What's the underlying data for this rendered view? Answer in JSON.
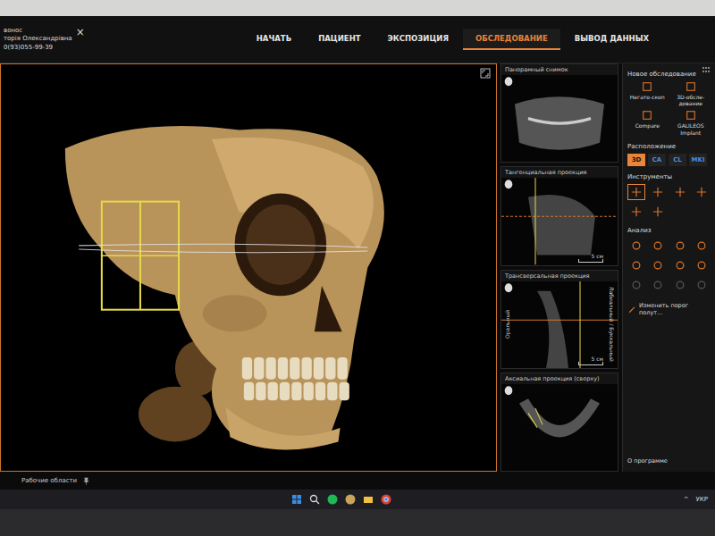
{
  "patient": {
    "lines": [
      "вонос",
      "торія Олександрівна",
      "0(93)055-99-39"
    ],
    "close": "×"
  },
  "nav": [
    {
      "label": "НАЧАТЬ",
      "selected": false
    },
    {
      "label": "ПАЦИЕНТ",
      "selected": false
    },
    {
      "label": "ЭКСПОЗИЦИЯ",
      "selected": false
    },
    {
      "label": "ОБСЛЕДОВАНИЕ",
      "selected": true
    },
    {
      "label": "ВЫВОД ДАННЫХ",
      "selected": false
    }
  ],
  "views": [
    {
      "title": "Панорамный снимок",
      "kind": "panorama",
      "scale": "",
      "side_labels": []
    },
    {
      "title": "Тангенциальная проекция",
      "kind": "tangential",
      "scale": "5 см",
      "side_labels": []
    },
    {
      "title": "Трансверсальная проекция",
      "kind": "transverse",
      "scale": "5 см",
      "side_labels": [
        "Оральный",
        "Лабиальный / Буккальный"
      ]
    },
    {
      "title": "Аксиальная проекция (сверху)",
      "kind": "axial",
      "scale": "",
      "side_labels": []
    }
  ],
  "tools_panel": {
    "new_exam": {
      "title": "Новое обследование",
      "items": [
        {
          "label": "Негато-скоп"
        },
        {
          "label": "3D-обсле-дование"
        },
        {
          "label": "Compare"
        },
        {
          "label": "GALILEOS Implant"
        }
      ]
    },
    "layout": {
      "title": "Расположение",
      "options": [
        {
          "label": "3D",
          "selected": true
        },
        {
          "label": "CA",
          "selected": false
        },
        {
          "label": "CL",
          "selected": false
        },
        {
          "label": "MKI",
          "selected": false
        }
      ]
    },
    "instruments": {
      "title": "Инструменты",
      "tools": [
        {
          "selected": true
        },
        {
          "selected": false
        },
        {
          "selected": false
        },
        {
          "selected": false
        },
        {
          "selected": false
        },
        {
          "selected": false
        }
      ]
    },
    "analysis": {
      "title": "Анализ",
      "tools": [
        {
          "disabled": false
        },
        {
          "disabled": false
        },
        {
          "disabled": false
        },
        {
          "disabled": false
        },
        {
          "disabled": false
        },
        {
          "disabled": false
        },
        {
          "disabled": false
        },
        {
          "disabled": false
        },
        {
          "disabled": true
        },
        {
          "disabled": true
        },
        {
          "disabled": true
        },
        {
          "disabled": true
        }
      ],
      "threshold": "Изменить порог полут…"
    },
    "about": "О программе"
  },
  "workspace": {
    "label": "Рабочие области"
  },
  "taskbar": {
    "tray": [
      "^",
      "УКР"
    ]
  }
}
